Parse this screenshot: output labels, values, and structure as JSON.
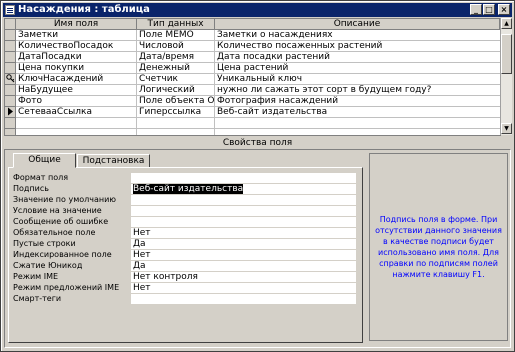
{
  "window": {
    "title": "Насаждения : таблица"
  },
  "grid": {
    "headers": [
      "Имя поля",
      "Тип данных",
      "Описание"
    ],
    "rows": [
      {
        "indicator": "",
        "name": "Заметки",
        "type": "Поле MEMO",
        "desc": "Заметки о насаждениях"
      },
      {
        "indicator": "",
        "name": "КоличествоПосадок",
        "type": "Числовой",
        "desc": "Количество посаженных растений"
      },
      {
        "indicator": "",
        "name": "ДатаПосадки",
        "type": "Дата/время",
        "desc": "Дата посадки растений"
      },
      {
        "indicator": "",
        "name": "Цена покупки",
        "type": "Денежный",
        "desc": "Цена растений"
      },
      {
        "indicator": "key",
        "name": "КлючНасаждений",
        "type": "Счетчик",
        "desc": "Уникальный ключ"
      },
      {
        "indicator": "",
        "name": "НаБудущее",
        "type": "Логический",
        "desc": "нужно ли сажать этот сорт в будущем году?"
      },
      {
        "indicator": "",
        "name": "Фото",
        "type": "Поле объекта OLE",
        "desc": "Фотография насаждений"
      },
      {
        "indicator": "arrow",
        "name": "СетевааСсылка",
        "type": "Гиперссылка",
        "desc": "Веб-сайт издательства"
      },
      {
        "indicator": "",
        "name": "",
        "type": "",
        "desc": ""
      },
      {
        "indicator": "",
        "name": "",
        "type": "",
        "desc": ""
      }
    ]
  },
  "properties": {
    "title": "Свойства поля",
    "tabs": [
      "Общие",
      "Подстановка"
    ],
    "items": [
      {
        "label": "Формат поля",
        "value": ""
      },
      {
        "label": "Подпись",
        "value": "Веб-сайт издательства"
      },
      {
        "label": "Значение по умолчанию",
        "value": ""
      },
      {
        "label": "Условие на значение",
        "value": ""
      },
      {
        "label": "Сообщение об ошибке",
        "value": ""
      },
      {
        "label": "Обязательное поле",
        "value": "Нет"
      },
      {
        "label": "Пустые строки",
        "value": "Да"
      },
      {
        "label": "Индексированное поле",
        "value": "Нет"
      },
      {
        "label": "Сжатие Юникод",
        "value": "Да"
      },
      {
        "label": "Режим IME",
        "value": "Нет контроля"
      },
      {
        "label": "Режим предложений IME",
        "value": "Нет"
      },
      {
        "label": "Смарт-теги",
        "value": ""
      }
    ],
    "hint": "Подпись поля в форме. При отсутствии данного значения в качестве подписи будет использовано имя поля. Для справки по подписям полей нажмите клавишу F1."
  }
}
